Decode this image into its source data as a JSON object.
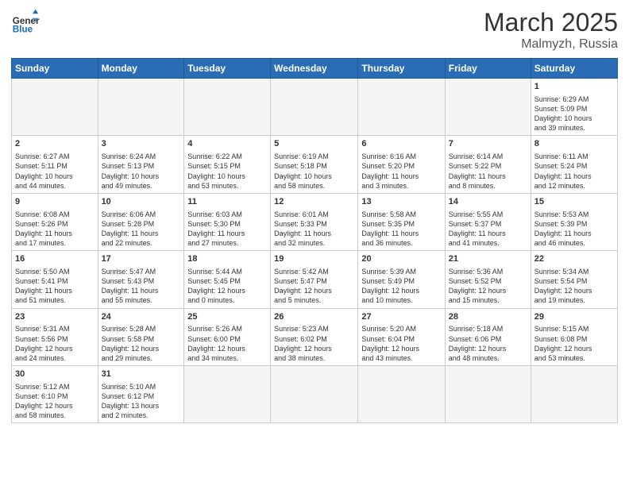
{
  "header": {
    "logo_general": "General",
    "logo_blue": "Blue",
    "month_year": "March 2025",
    "location": "Malmyzh, Russia"
  },
  "weekdays": [
    "Sunday",
    "Monday",
    "Tuesday",
    "Wednesday",
    "Thursday",
    "Friday",
    "Saturday"
  ],
  "weeks": [
    [
      {
        "day": "",
        "info": ""
      },
      {
        "day": "",
        "info": ""
      },
      {
        "day": "",
        "info": ""
      },
      {
        "day": "",
        "info": ""
      },
      {
        "day": "",
        "info": ""
      },
      {
        "day": "",
        "info": ""
      },
      {
        "day": "1",
        "info": "Sunrise: 6:29 AM\nSunset: 5:09 PM\nDaylight: 10 hours\nand 39 minutes."
      }
    ],
    [
      {
        "day": "2",
        "info": "Sunrise: 6:27 AM\nSunset: 5:11 PM\nDaylight: 10 hours\nand 44 minutes."
      },
      {
        "day": "3",
        "info": "Sunrise: 6:24 AM\nSunset: 5:13 PM\nDaylight: 10 hours\nand 49 minutes."
      },
      {
        "day": "4",
        "info": "Sunrise: 6:22 AM\nSunset: 5:15 PM\nDaylight: 10 hours\nand 53 minutes."
      },
      {
        "day": "5",
        "info": "Sunrise: 6:19 AM\nSunset: 5:18 PM\nDaylight: 10 hours\nand 58 minutes."
      },
      {
        "day": "6",
        "info": "Sunrise: 6:16 AM\nSunset: 5:20 PM\nDaylight: 11 hours\nand 3 minutes."
      },
      {
        "day": "7",
        "info": "Sunrise: 6:14 AM\nSunset: 5:22 PM\nDaylight: 11 hours\nand 8 minutes."
      },
      {
        "day": "8",
        "info": "Sunrise: 6:11 AM\nSunset: 5:24 PM\nDaylight: 11 hours\nand 12 minutes."
      }
    ],
    [
      {
        "day": "9",
        "info": "Sunrise: 6:08 AM\nSunset: 5:26 PM\nDaylight: 11 hours\nand 17 minutes."
      },
      {
        "day": "10",
        "info": "Sunrise: 6:06 AM\nSunset: 5:28 PM\nDaylight: 11 hours\nand 22 minutes."
      },
      {
        "day": "11",
        "info": "Sunrise: 6:03 AM\nSunset: 5:30 PM\nDaylight: 11 hours\nand 27 minutes."
      },
      {
        "day": "12",
        "info": "Sunrise: 6:01 AM\nSunset: 5:33 PM\nDaylight: 11 hours\nand 32 minutes."
      },
      {
        "day": "13",
        "info": "Sunrise: 5:58 AM\nSunset: 5:35 PM\nDaylight: 11 hours\nand 36 minutes."
      },
      {
        "day": "14",
        "info": "Sunrise: 5:55 AM\nSunset: 5:37 PM\nDaylight: 11 hours\nand 41 minutes."
      },
      {
        "day": "15",
        "info": "Sunrise: 5:53 AM\nSunset: 5:39 PM\nDaylight: 11 hours\nand 46 minutes."
      }
    ],
    [
      {
        "day": "16",
        "info": "Sunrise: 5:50 AM\nSunset: 5:41 PM\nDaylight: 11 hours\nand 51 minutes."
      },
      {
        "day": "17",
        "info": "Sunrise: 5:47 AM\nSunset: 5:43 PM\nDaylight: 11 hours\nand 55 minutes."
      },
      {
        "day": "18",
        "info": "Sunrise: 5:44 AM\nSunset: 5:45 PM\nDaylight: 12 hours\nand 0 minutes."
      },
      {
        "day": "19",
        "info": "Sunrise: 5:42 AM\nSunset: 5:47 PM\nDaylight: 12 hours\nand 5 minutes."
      },
      {
        "day": "20",
        "info": "Sunrise: 5:39 AM\nSunset: 5:49 PM\nDaylight: 12 hours\nand 10 minutes."
      },
      {
        "day": "21",
        "info": "Sunrise: 5:36 AM\nSunset: 5:52 PM\nDaylight: 12 hours\nand 15 minutes."
      },
      {
        "day": "22",
        "info": "Sunrise: 5:34 AM\nSunset: 5:54 PM\nDaylight: 12 hours\nand 19 minutes."
      }
    ],
    [
      {
        "day": "23",
        "info": "Sunrise: 5:31 AM\nSunset: 5:56 PM\nDaylight: 12 hours\nand 24 minutes."
      },
      {
        "day": "24",
        "info": "Sunrise: 5:28 AM\nSunset: 5:58 PM\nDaylight: 12 hours\nand 29 minutes."
      },
      {
        "day": "25",
        "info": "Sunrise: 5:26 AM\nSunset: 6:00 PM\nDaylight: 12 hours\nand 34 minutes."
      },
      {
        "day": "26",
        "info": "Sunrise: 5:23 AM\nSunset: 6:02 PM\nDaylight: 12 hours\nand 38 minutes."
      },
      {
        "day": "27",
        "info": "Sunrise: 5:20 AM\nSunset: 6:04 PM\nDaylight: 12 hours\nand 43 minutes."
      },
      {
        "day": "28",
        "info": "Sunrise: 5:18 AM\nSunset: 6:06 PM\nDaylight: 12 hours\nand 48 minutes."
      },
      {
        "day": "29",
        "info": "Sunrise: 5:15 AM\nSunset: 6:08 PM\nDaylight: 12 hours\nand 53 minutes."
      }
    ],
    [
      {
        "day": "30",
        "info": "Sunrise: 5:12 AM\nSunset: 6:10 PM\nDaylight: 12 hours\nand 58 minutes."
      },
      {
        "day": "31",
        "info": "Sunrise: 5:10 AM\nSunset: 6:12 PM\nDaylight: 13 hours\nand 2 minutes."
      },
      {
        "day": "",
        "info": ""
      },
      {
        "day": "",
        "info": ""
      },
      {
        "day": "",
        "info": ""
      },
      {
        "day": "",
        "info": ""
      },
      {
        "day": "",
        "info": ""
      }
    ]
  ]
}
